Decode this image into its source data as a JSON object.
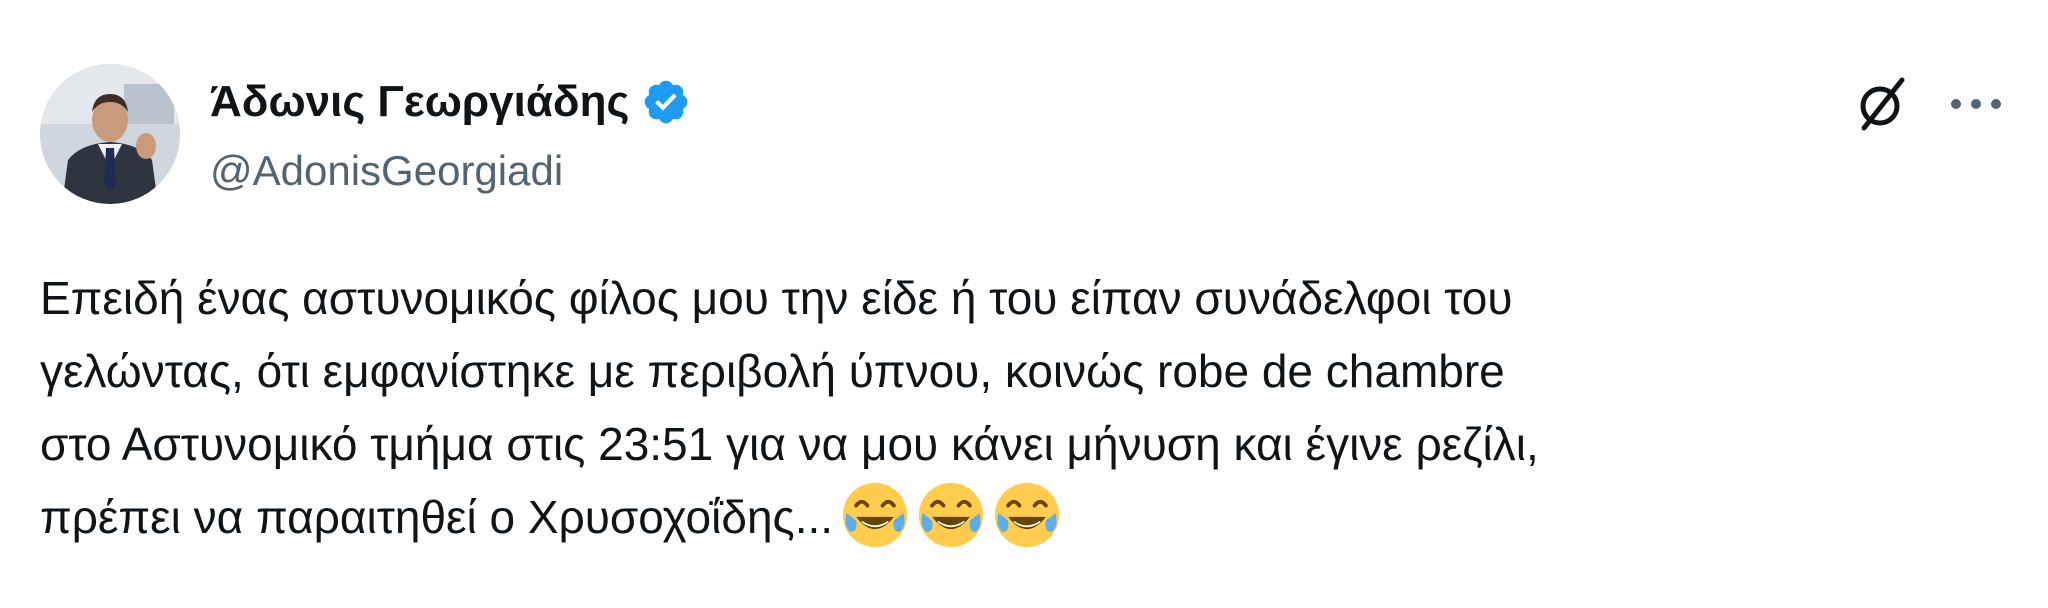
{
  "author": {
    "display_name": "Άδωνις Γεωργιάδης",
    "handle": "@AdonisGeorgiadi",
    "verified": true,
    "avatar": "avatar-photo"
  },
  "header_actions": {
    "grok_icon": "slashed-circle-icon",
    "more_icon": "more-horizontal-icon",
    "more_label": "···"
  },
  "tweet": {
    "lines": [
      "Επειδή ένας αστυνομικός φίλος μου την είδε ή του είπαν συνάδελφοι του",
      "γελώντας, ότι εμφανίστηκε με περιβολή ύπνου, κοινώς robe de chambre",
      "στο Αστυνομικό τμήμα στις 23:51 για να μου κάνει μήνυση και έγινε ρεζίλι,",
      "πρέπει να παραιτηθεί ο Χρυσοχοΐδης..."
    ],
    "emojis": [
      "face-with-tears-of-joy",
      "face-with-tears-of-joy",
      "face-with-tears-of-joy"
    ]
  },
  "colors": {
    "text": "#0f1419",
    "secondary_text": "#536471",
    "verified_blue": "#1d9bf0",
    "emoji_yellow": "#ffcc4d",
    "tear_blue": "#5dadec"
  }
}
